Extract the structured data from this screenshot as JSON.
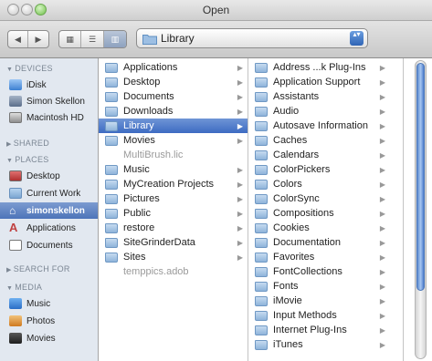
{
  "window": {
    "title": "Open"
  },
  "toolbar": {
    "back_icon": "◀",
    "forward_icon": "▶",
    "icon_view_icon": "▦",
    "list_view_icon": "☰",
    "column_view_icon": "▥",
    "path_label": "Library",
    "path_arrows": "▴▾"
  },
  "sidebar": {
    "devices_header": "DEVICES",
    "shared_header": "SHARED",
    "places_header": "PLACES",
    "search_header": "SEARCH FOR",
    "media_header": "MEDIA",
    "devices": [
      {
        "label": "iDisk"
      },
      {
        "label": "Simon Skellon"
      },
      {
        "label": "Macintosh HD"
      }
    ],
    "places": [
      {
        "label": "Desktop"
      },
      {
        "label": "Current Work"
      },
      {
        "label": "simonskellon"
      },
      {
        "label": "Applications"
      },
      {
        "label": "Documents"
      }
    ],
    "media": [
      {
        "label": "Music"
      },
      {
        "label": "Photos"
      },
      {
        "label": "Movies"
      }
    ]
  },
  "column1": {
    "items": [
      {
        "name": "Applications"
      },
      {
        "name": "Desktop"
      },
      {
        "name": "Documents"
      },
      {
        "name": "Downloads"
      },
      {
        "name": "Library"
      },
      {
        "name": "Movies"
      },
      {
        "name": "MultiBrush.lic"
      },
      {
        "name": "Music"
      },
      {
        "name": "MyCreation Projects"
      },
      {
        "name": "Pictures"
      },
      {
        "name": "Public"
      },
      {
        "name": "restore"
      },
      {
        "name": "SiteGrinderData"
      },
      {
        "name": "Sites"
      },
      {
        "name": "temppics.adob"
      }
    ]
  },
  "column2": {
    "items": [
      {
        "name": "Address ...k Plug-Ins"
      },
      {
        "name": "Application Support"
      },
      {
        "name": "Assistants"
      },
      {
        "name": "Audio"
      },
      {
        "name": "Autosave Information"
      },
      {
        "name": "Caches"
      },
      {
        "name": "Calendars"
      },
      {
        "name": "ColorPickers"
      },
      {
        "name": "Colors"
      },
      {
        "name": "ColorSync"
      },
      {
        "name": "Compositions"
      },
      {
        "name": "Cookies"
      },
      {
        "name": "Documentation"
      },
      {
        "name": "Favorites"
      },
      {
        "name": "FontCollections"
      },
      {
        "name": "Fonts"
      },
      {
        "name": "iMovie"
      },
      {
        "name": "Input Methods"
      },
      {
        "name": "Internet Plug-Ins"
      },
      {
        "name": "iTunes"
      }
    ]
  },
  "colors": {
    "selection": "#4d74b9",
    "sidebar_bg": "#e2e8f0"
  }
}
